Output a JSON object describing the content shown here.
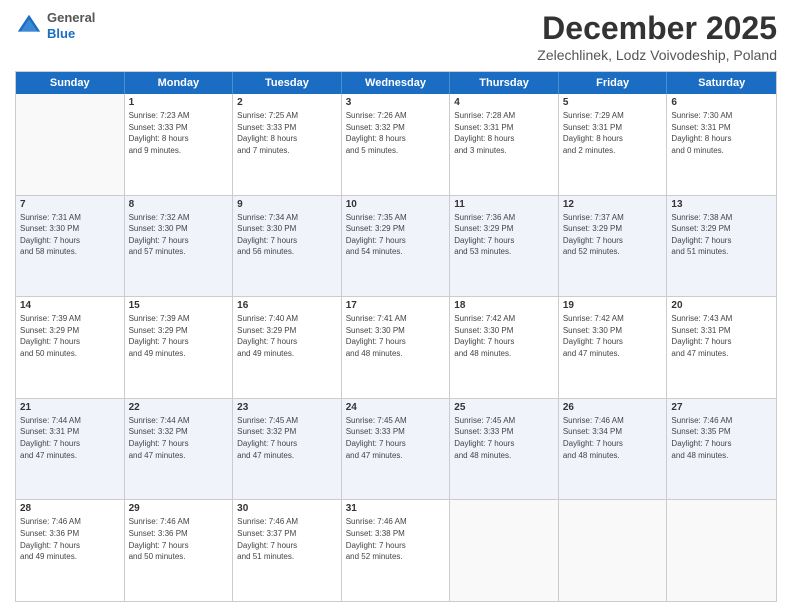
{
  "header": {
    "logo_general": "General",
    "logo_blue": "Blue",
    "month_title": "December 2025",
    "location": "Zelechlinek, Lodz Voivodeship, Poland"
  },
  "weekdays": [
    "Sunday",
    "Monday",
    "Tuesday",
    "Wednesday",
    "Thursday",
    "Friday",
    "Saturday"
  ],
  "rows": [
    [
      {
        "day": "",
        "lines": []
      },
      {
        "day": "1",
        "lines": [
          "Sunrise: 7:23 AM",
          "Sunset: 3:33 PM",
          "Daylight: 8 hours",
          "and 9 minutes."
        ]
      },
      {
        "day": "2",
        "lines": [
          "Sunrise: 7:25 AM",
          "Sunset: 3:33 PM",
          "Daylight: 8 hours",
          "and 7 minutes."
        ]
      },
      {
        "day": "3",
        "lines": [
          "Sunrise: 7:26 AM",
          "Sunset: 3:32 PM",
          "Daylight: 8 hours",
          "and 5 minutes."
        ]
      },
      {
        "day": "4",
        "lines": [
          "Sunrise: 7:28 AM",
          "Sunset: 3:31 PM",
          "Daylight: 8 hours",
          "and 3 minutes."
        ]
      },
      {
        "day": "5",
        "lines": [
          "Sunrise: 7:29 AM",
          "Sunset: 3:31 PM",
          "Daylight: 8 hours",
          "and 2 minutes."
        ]
      },
      {
        "day": "6",
        "lines": [
          "Sunrise: 7:30 AM",
          "Sunset: 3:31 PM",
          "Daylight: 8 hours",
          "and 0 minutes."
        ]
      }
    ],
    [
      {
        "day": "7",
        "lines": [
          "Sunrise: 7:31 AM",
          "Sunset: 3:30 PM",
          "Daylight: 7 hours",
          "and 58 minutes."
        ]
      },
      {
        "day": "8",
        "lines": [
          "Sunrise: 7:32 AM",
          "Sunset: 3:30 PM",
          "Daylight: 7 hours",
          "and 57 minutes."
        ]
      },
      {
        "day": "9",
        "lines": [
          "Sunrise: 7:34 AM",
          "Sunset: 3:30 PM",
          "Daylight: 7 hours",
          "and 56 minutes."
        ]
      },
      {
        "day": "10",
        "lines": [
          "Sunrise: 7:35 AM",
          "Sunset: 3:29 PM",
          "Daylight: 7 hours",
          "and 54 minutes."
        ]
      },
      {
        "day": "11",
        "lines": [
          "Sunrise: 7:36 AM",
          "Sunset: 3:29 PM",
          "Daylight: 7 hours",
          "and 53 minutes."
        ]
      },
      {
        "day": "12",
        "lines": [
          "Sunrise: 7:37 AM",
          "Sunset: 3:29 PM",
          "Daylight: 7 hours",
          "and 52 minutes."
        ]
      },
      {
        "day": "13",
        "lines": [
          "Sunrise: 7:38 AM",
          "Sunset: 3:29 PM",
          "Daylight: 7 hours",
          "and 51 minutes."
        ]
      }
    ],
    [
      {
        "day": "14",
        "lines": [
          "Sunrise: 7:39 AM",
          "Sunset: 3:29 PM",
          "Daylight: 7 hours",
          "and 50 minutes."
        ]
      },
      {
        "day": "15",
        "lines": [
          "Sunrise: 7:39 AM",
          "Sunset: 3:29 PM",
          "Daylight: 7 hours",
          "and 49 minutes."
        ]
      },
      {
        "day": "16",
        "lines": [
          "Sunrise: 7:40 AM",
          "Sunset: 3:29 PM",
          "Daylight: 7 hours",
          "and 49 minutes."
        ]
      },
      {
        "day": "17",
        "lines": [
          "Sunrise: 7:41 AM",
          "Sunset: 3:30 PM",
          "Daylight: 7 hours",
          "and 48 minutes."
        ]
      },
      {
        "day": "18",
        "lines": [
          "Sunrise: 7:42 AM",
          "Sunset: 3:30 PM",
          "Daylight: 7 hours",
          "and 48 minutes."
        ]
      },
      {
        "day": "19",
        "lines": [
          "Sunrise: 7:42 AM",
          "Sunset: 3:30 PM",
          "Daylight: 7 hours",
          "and 47 minutes."
        ]
      },
      {
        "day": "20",
        "lines": [
          "Sunrise: 7:43 AM",
          "Sunset: 3:31 PM",
          "Daylight: 7 hours",
          "and 47 minutes."
        ]
      }
    ],
    [
      {
        "day": "21",
        "lines": [
          "Sunrise: 7:44 AM",
          "Sunset: 3:31 PM",
          "Daylight: 7 hours",
          "and 47 minutes."
        ]
      },
      {
        "day": "22",
        "lines": [
          "Sunrise: 7:44 AM",
          "Sunset: 3:32 PM",
          "Daylight: 7 hours",
          "and 47 minutes."
        ]
      },
      {
        "day": "23",
        "lines": [
          "Sunrise: 7:45 AM",
          "Sunset: 3:32 PM",
          "Daylight: 7 hours",
          "and 47 minutes."
        ]
      },
      {
        "day": "24",
        "lines": [
          "Sunrise: 7:45 AM",
          "Sunset: 3:33 PM",
          "Daylight: 7 hours",
          "and 47 minutes."
        ]
      },
      {
        "day": "25",
        "lines": [
          "Sunrise: 7:45 AM",
          "Sunset: 3:33 PM",
          "Daylight: 7 hours",
          "and 48 minutes."
        ]
      },
      {
        "day": "26",
        "lines": [
          "Sunrise: 7:46 AM",
          "Sunset: 3:34 PM",
          "Daylight: 7 hours",
          "and 48 minutes."
        ]
      },
      {
        "day": "27",
        "lines": [
          "Sunrise: 7:46 AM",
          "Sunset: 3:35 PM",
          "Daylight: 7 hours",
          "and 48 minutes."
        ]
      }
    ],
    [
      {
        "day": "28",
        "lines": [
          "Sunrise: 7:46 AM",
          "Sunset: 3:36 PM",
          "Daylight: 7 hours",
          "and 49 minutes."
        ]
      },
      {
        "day": "29",
        "lines": [
          "Sunrise: 7:46 AM",
          "Sunset: 3:36 PM",
          "Daylight: 7 hours",
          "and 50 minutes."
        ]
      },
      {
        "day": "30",
        "lines": [
          "Sunrise: 7:46 AM",
          "Sunset: 3:37 PM",
          "Daylight: 7 hours",
          "and 51 minutes."
        ]
      },
      {
        "day": "31",
        "lines": [
          "Sunrise: 7:46 AM",
          "Sunset: 3:38 PM",
          "Daylight: 7 hours",
          "and 52 minutes."
        ]
      },
      {
        "day": "",
        "lines": []
      },
      {
        "day": "",
        "lines": []
      },
      {
        "day": "",
        "lines": []
      }
    ]
  ]
}
